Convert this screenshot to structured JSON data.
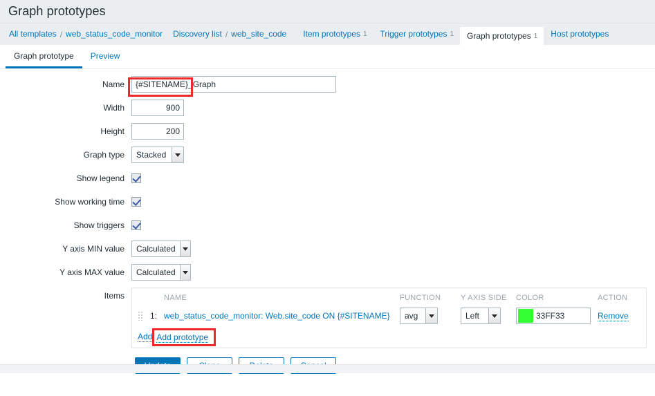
{
  "page": {
    "title": "Graph prototypes"
  },
  "breadcrumb": {
    "separator": "/",
    "groups": [
      {
        "links": [
          {
            "label": "All templates",
            "count": ""
          },
          {
            "label": "web_status_code_monitor",
            "count": ""
          }
        ]
      },
      {
        "links": [
          {
            "label": "Discovery list",
            "count": ""
          },
          {
            "label": "web_site_code",
            "count": ""
          }
        ]
      }
    ],
    "items": [
      {
        "label": "Item prototypes",
        "count": "1",
        "selected": false
      },
      {
        "label": "Trigger prototypes",
        "count": "1",
        "selected": false
      },
      {
        "label": "Graph prototypes",
        "count": "1",
        "selected": true
      },
      {
        "label": "Host prototypes",
        "count": "",
        "selected": false
      }
    ]
  },
  "tabs": [
    {
      "label": "Graph prototype",
      "active": true
    },
    {
      "label": "Preview",
      "active": false
    }
  ],
  "form": {
    "name": {
      "label": "Name",
      "value": "{#SITENAME}_Graph",
      "placeholder": ""
    },
    "width": {
      "label": "Width",
      "value": "900"
    },
    "height": {
      "label": "Height",
      "value": "200"
    },
    "graph_type": {
      "label": "Graph type",
      "value": "Stacked"
    },
    "show_legend": {
      "label": "Show legend",
      "checked": true
    },
    "show_working_time": {
      "label": "Show working time",
      "checked": true
    },
    "show_triggers": {
      "label": "Show triggers",
      "checked": true
    },
    "y_axis_min": {
      "label": "Y axis MIN value",
      "value": "Calculated"
    },
    "y_axis_max": {
      "label": "Y axis MAX value",
      "value": "Calculated"
    },
    "items": {
      "label": "Items",
      "columns": {
        "name": "NAME",
        "function": "FUNCTION",
        "y_axis_side": "Y AXIS SIDE",
        "color": "COLOR",
        "action": "ACTION"
      },
      "rows": [
        {
          "index": "1:",
          "name": "web_status_code_monitor: Web.site_code ON {#SITENAME}",
          "function": "avg",
          "y_axis_side": "Left",
          "color_hex": "#33FF33",
          "color_value": "33FF33",
          "action": "Remove"
        }
      ],
      "add_label": "Add",
      "add_prototype_label": "Add prototype"
    }
  },
  "buttons": [
    {
      "label": "Update",
      "primary": true
    },
    {
      "label": "Clone",
      "primary": false
    },
    {
      "label": "Delete",
      "primary": false
    },
    {
      "label": "Cancel",
      "primary": false
    }
  ],
  "annotations": {
    "highlight_color": "#EF2929",
    "name_variable_box": "{#SITENAME}",
    "add_prototype_box": "Add prototype"
  }
}
